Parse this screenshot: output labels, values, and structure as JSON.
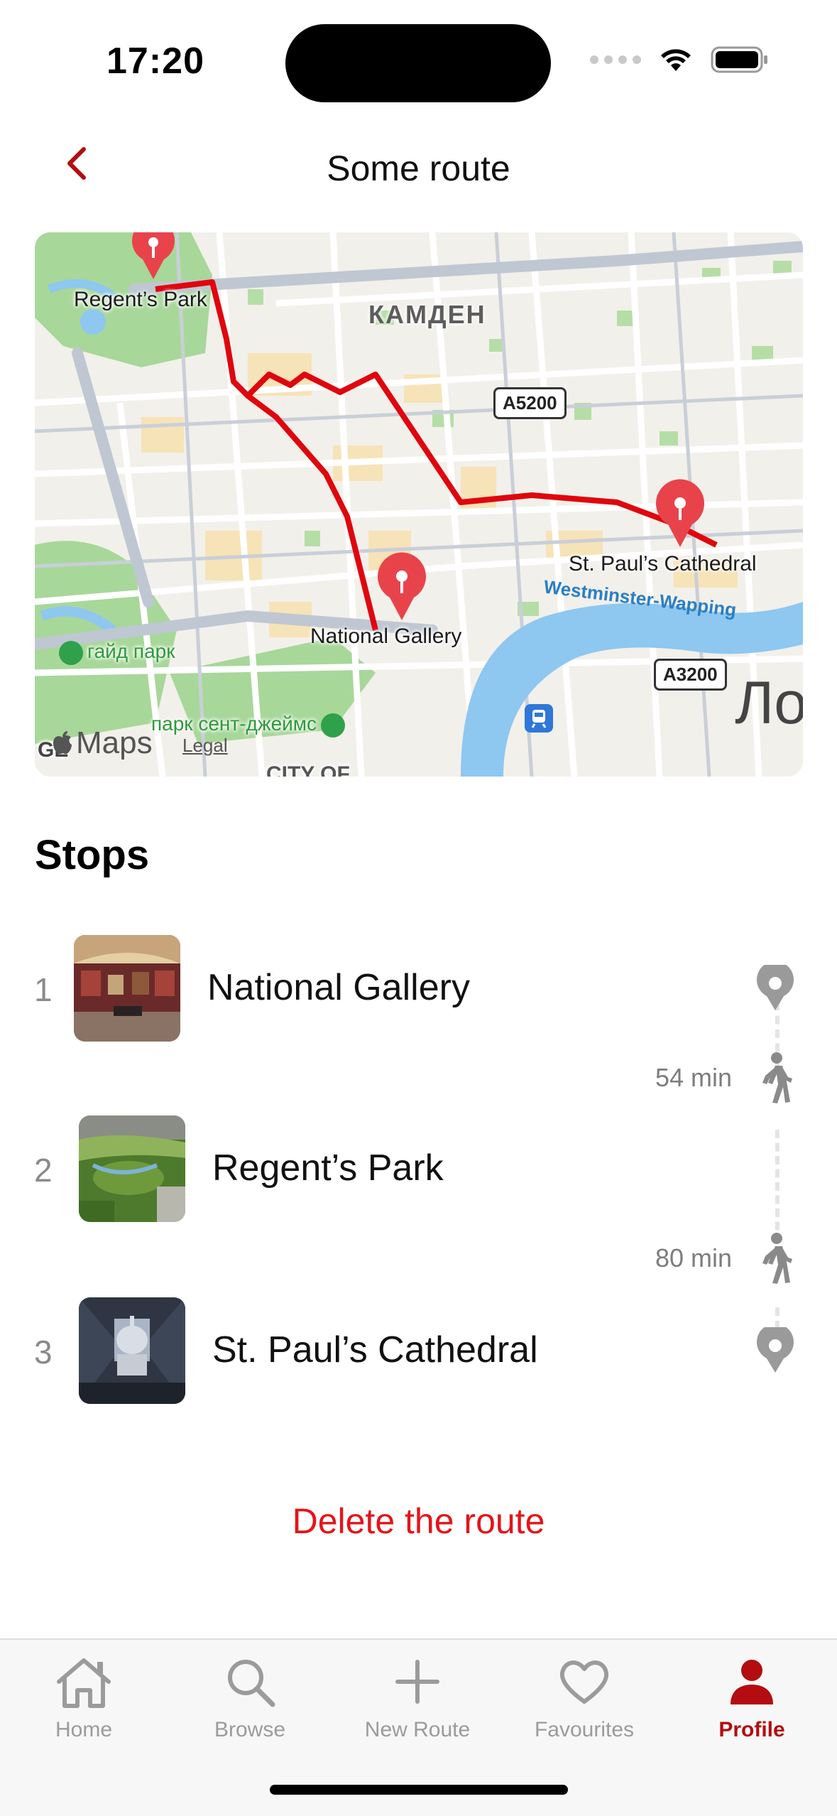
{
  "status_bar": {
    "time": "17:20"
  },
  "nav": {
    "title": "Some route"
  },
  "map": {
    "pins": [
      "Regent’s Park",
      "St. Paul’s Cathedral",
      "National Gallery"
    ],
    "district_label": "КАМДЕН",
    "road_a5200": "A5200",
    "road_a3200": "A3200",
    "river_label": "Westminster-Wapping",
    "park_hyde": "гайд парк",
    "park_st_james": "парк сент-джеймс",
    "city_of": "CITY OF",
    "edge_text_left": "GE",
    "edge_text_right": "Ло",
    "maps_logo_text": "Maps",
    "legal_label": "Legal"
  },
  "stops_section": {
    "title": "Stops",
    "stops": [
      {
        "index": "1",
        "name": "National Gallery",
        "thumb_colors": [
          "#6a2a2a",
          "#a5433a"
        ]
      },
      {
        "index": "2",
        "name": "Regent’s Park",
        "thumb_colors": [
          "#4d7a2c",
          "#8fb35a"
        ]
      },
      {
        "index": "3",
        "name": "St. Paul’s Cathedral",
        "thumb_colors": [
          "#2f3542",
          "#a9b5c6"
        ]
      }
    ],
    "walks": [
      {
        "time": "54 min"
      },
      {
        "time": "80 min"
      }
    ]
  },
  "delete_label": "Delete the route",
  "tabs": [
    {
      "label": "Home",
      "icon": "house-icon",
      "active": false
    },
    {
      "label": "Browse",
      "icon": "magnifier-icon",
      "active": false
    },
    {
      "label": "New Route",
      "icon": "plus-icon",
      "active": false
    },
    {
      "label": "Favourites",
      "icon": "heart-icon",
      "active": false
    },
    {
      "label": "Profile",
      "icon": "person-icon",
      "active": true
    }
  ],
  "colors": {
    "accent": "#b30d10",
    "route_line": "#e0060d",
    "pin": "#e8434b",
    "delete_text": "#e3151a",
    "inactive_tab": "#9b9b9b"
  }
}
